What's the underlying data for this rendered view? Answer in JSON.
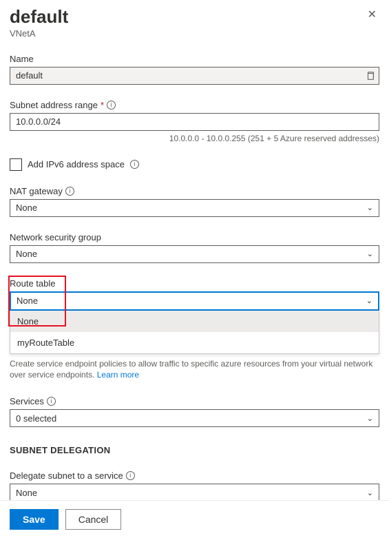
{
  "header": {
    "title": "default",
    "subtitle": "VNetA"
  },
  "name_field": {
    "label": "Name",
    "value": "default"
  },
  "subnet_range": {
    "label": "Subnet address range",
    "value": "10.0.0.0/24",
    "helper": "10.0.0.0 - 10.0.0.255 (251 + 5 Azure reserved addresses)"
  },
  "ipv6_checkbox": {
    "label": "Add IPv6 address space"
  },
  "nat_gateway": {
    "label": "NAT gateway",
    "value": "None"
  },
  "nsg": {
    "label": "Network security group",
    "value": "None"
  },
  "route_table": {
    "label": "Route table",
    "value": "None",
    "options": {
      "opt0": "None",
      "opt1": "myRouteTable"
    }
  },
  "service_endpoints": {
    "description": "Create service endpoint policies to allow traffic to specific azure resources from your virtual network over service endpoints. ",
    "learn_more": "Learn more"
  },
  "services": {
    "label": "Services",
    "value": "0 selected"
  },
  "delegation": {
    "heading": "SUBNET DELEGATION",
    "label": "Delegate subnet to a service",
    "value": "None"
  },
  "footer": {
    "save": "Save",
    "cancel": "Cancel"
  }
}
